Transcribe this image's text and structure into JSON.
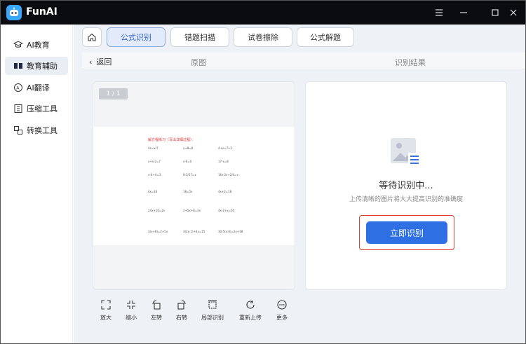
{
  "app": {
    "title": "FunAI"
  },
  "sidebar": {
    "items": [
      {
        "label": "AI教育",
        "icon": "graduation-cap-icon"
      },
      {
        "label": "教育辅助",
        "icon": "book-icon"
      },
      {
        "label": "AI翻译",
        "icon": "translate-icon"
      },
      {
        "label": "压缩工具",
        "icon": "compress-icon"
      },
      {
        "label": "转换工具",
        "icon": "convert-icon"
      }
    ]
  },
  "tabs": [
    "公式识别",
    "错题扫描",
    "试卷擦除",
    "公式解题"
  ],
  "subheader": {
    "back": "返回",
    "original": "原图",
    "result": "识别结果"
  },
  "preview": {
    "page_indicator": "1 / 1",
    "doc_title": "解方程练习（写出详细过程）：",
    "equations": [
      "4x=x/7",
      "x+8=8",
      "4+x=7+5",
      "x+x-2=7",
      "x-6=0",
      "17-x=8",
      "x-6+4=3",
      "8-3/17=x",
      "16+2x+2/4=x",
      "4x=16",
      "18=5x",
      "4x+2=18",
      "24x+10=2x",
      "2+5x+8=3x",
      "4x-2+x=50",
      "3(x+8)=2+5x",
      "3(2x-1)+3x=15",
      "30-5(x-6)=2x+18"
    ]
  },
  "result": {
    "status": "等待识别中...",
    "hint": "上传清晰的图片将大大提高识别的准确度",
    "button": "立即识别"
  },
  "tools": [
    "放大",
    "缩小",
    "左转",
    "右转",
    "局部识别",
    "重新上传",
    "更多"
  ],
  "colors": {
    "accent": "#2f6fe4",
    "highlight": "#e03c30",
    "titlebar": "#0b0c10"
  }
}
